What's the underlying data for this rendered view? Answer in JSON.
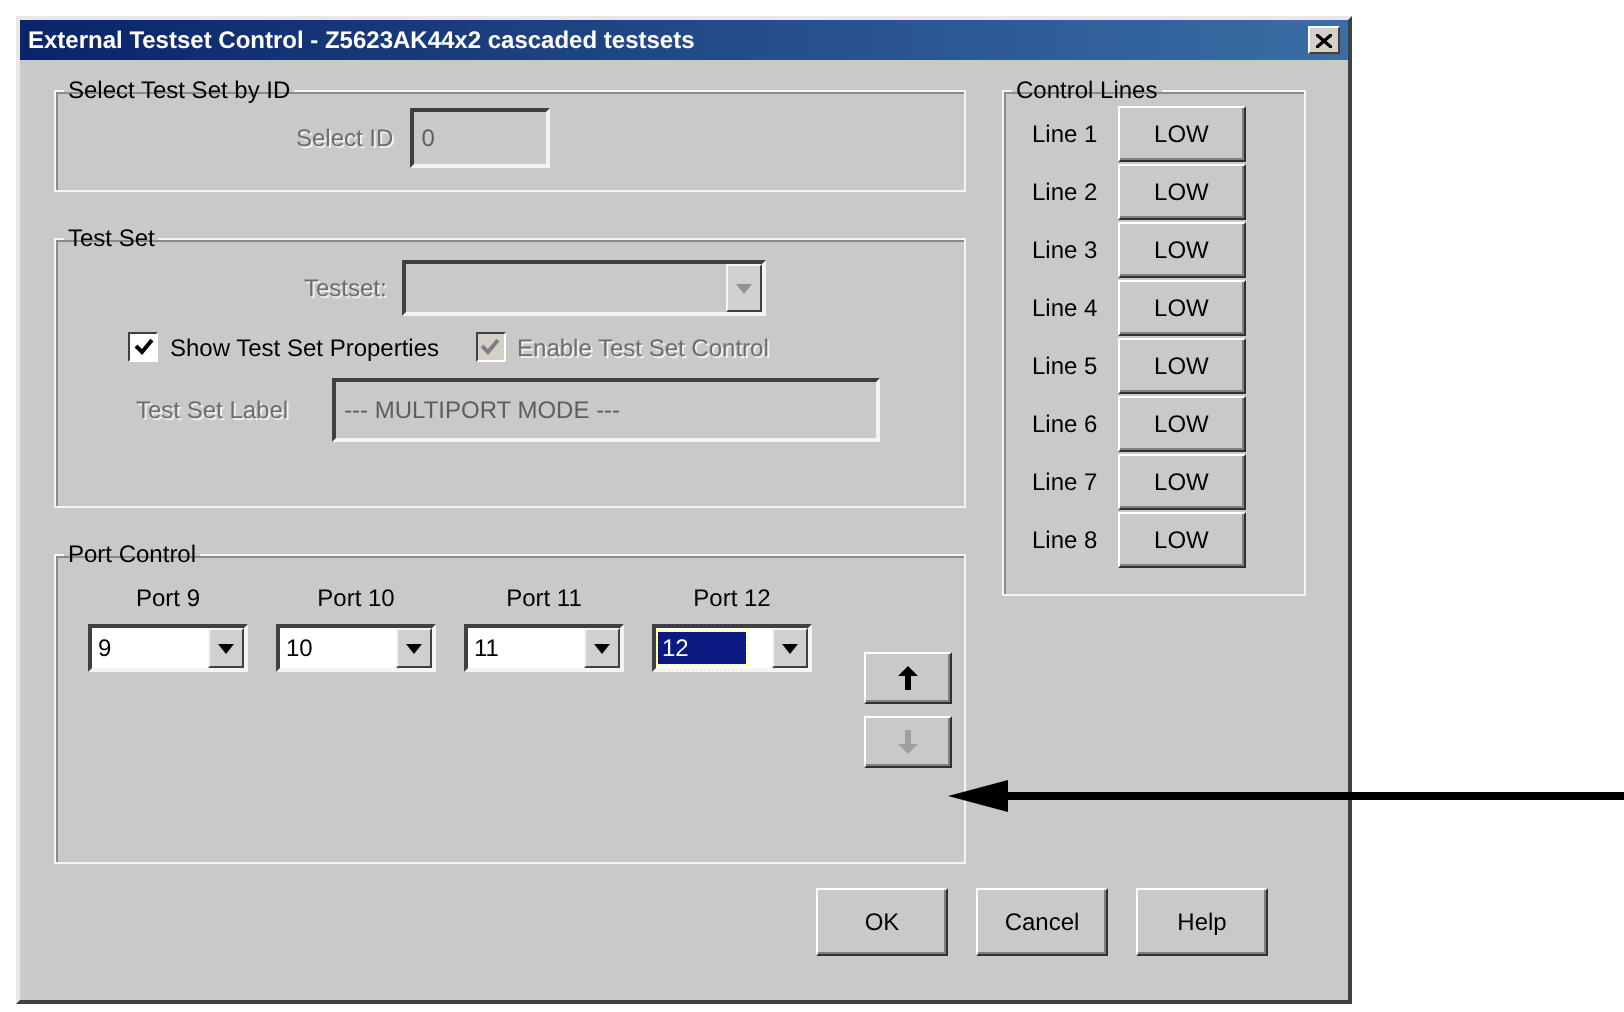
{
  "window": {
    "title": "External Testset Control - Z5623AK44x2 cascaded testsets"
  },
  "select_by_id": {
    "title": "Select Test Set by ID",
    "label": "Select ID",
    "value": "0",
    "disabled": true
  },
  "test_set": {
    "title": "Test Set",
    "testset": {
      "label": "Testset:",
      "disabled": true
    },
    "show_properties": {
      "label": "Show Test Set Properties",
      "checked": true,
      "disabled": false
    },
    "enable_control": {
      "label": "Enable Test Set Control",
      "checked": true,
      "disabled": true
    },
    "set_label": {
      "label": "Test Set Label",
      "value": "--- MULTIPORT MODE ---",
      "disabled": true
    }
  },
  "port_control": {
    "title": "Port Control",
    "ports": [
      {
        "label": "Port 9",
        "value": "9",
        "selected": false
      },
      {
        "label": "Port 10",
        "value": "10",
        "selected": false
      },
      {
        "label": "Port 11",
        "value": "11",
        "selected": false
      },
      {
        "label": "Port 12",
        "value": "12",
        "selected": true
      }
    ],
    "move_up": {
      "disabled": false
    },
    "move_down": {
      "disabled": true
    }
  },
  "control_lines": {
    "title": "Control Lines",
    "lines": [
      {
        "label": "Line 1",
        "value": "LOW"
      },
      {
        "label": "Line 2",
        "value": "LOW"
      },
      {
        "label": "Line 3",
        "value": "LOW"
      },
      {
        "label": "Line 4",
        "value": "LOW"
      },
      {
        "label": "Line 5",
        "value": "LOW"
      },
      {
        "label": "Line 6",
        "value": "LOW"
      },
      {
        "label": "Line 7",
        "value": "LOW"
      },
      {
        "label": "Line 8",
        "value": "LOW"
      }
    ]
  },
  "buttons": [
    {
      "label": "OK"
    },
    {
      "label": "Cancel"
    },
    {
      "label": "Help"
    }
  ]
}
